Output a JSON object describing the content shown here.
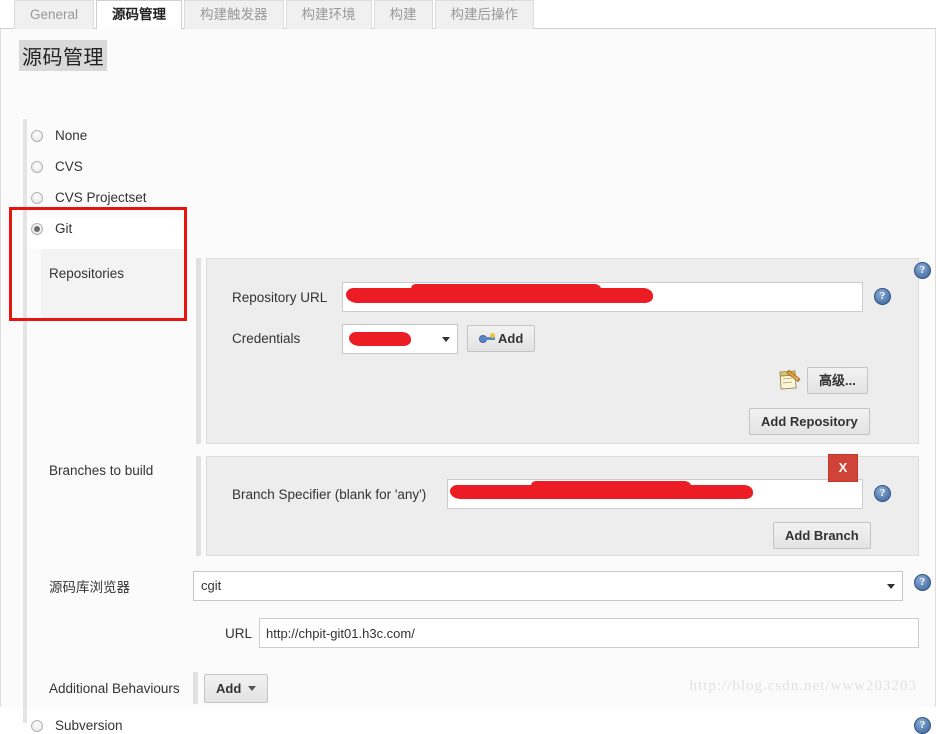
{
  "tabs": [
    {
      "label": "General",
      "active": false
    },
    {
      "label": "源码管理",
      "active": true
    },
    {
      "label": "构建触发器",
      "active": false
    },
    {
      "label": "构建环境",
      "active": false
    },
    {
      "label": "构建",
      "active": false
    },
    {
      "label": "构建后操作",
      "active": false
    }
  ],
  "page": {
    "title": "源码管理"
  },
  "scm_options": [
    {
      "label": "None",
      "checked": false
    },
    {
      "label": "CVS",
      "checked": false
    },
    {
      "label": "CVS Projectset",
      "checked": false
    },
    {
      "label": "Git",
      "checked": true
    },
    {
      "label": "Subversion",
      "checked": false
    }
  ],
  "git": {
    "repositories_label": "Repositories",
    "repository_url_label": "Repository URL",
    "repository_url_value": "",
    "credentials_label": "Credentials",
    "credentials_value": "",
    "add_credentials_label": "Add",
    "advanced_label": "高级...",
    "add_repository_label": "Add Repository",
    "branches_label": "Branches to build",
    "branch_specifier_label": "Branch Specifier (blank for 'any')",
    "branch_specifier_value": "",
    "delete_branch_label": "X",
    "add_branch_label": "Add Branch",
    "browser_label": "源码库浏览器",
    "browser_value": "cgit",
    "browser_url_label": "URL",
    "browser_url_value": "http://chpit-git01.h3c.com/",
    "additional_behaviours_label": "Additional Behaviours",
    "additional_add_label": "Add"
  },
  "help_icon_glyph": "?",
  "watermark": "http://blog.csdn.net/www203203",
  "colors": {
    "annotation_red": "#e8140f",
    "redaction_red": "#ec1c24",
    "delete_red": "#cf4436",
    "help_blue": "#3d6398",
    "panel_gray": "#ededed",
    "page_bg": "#fbfbfb"
  }
}
